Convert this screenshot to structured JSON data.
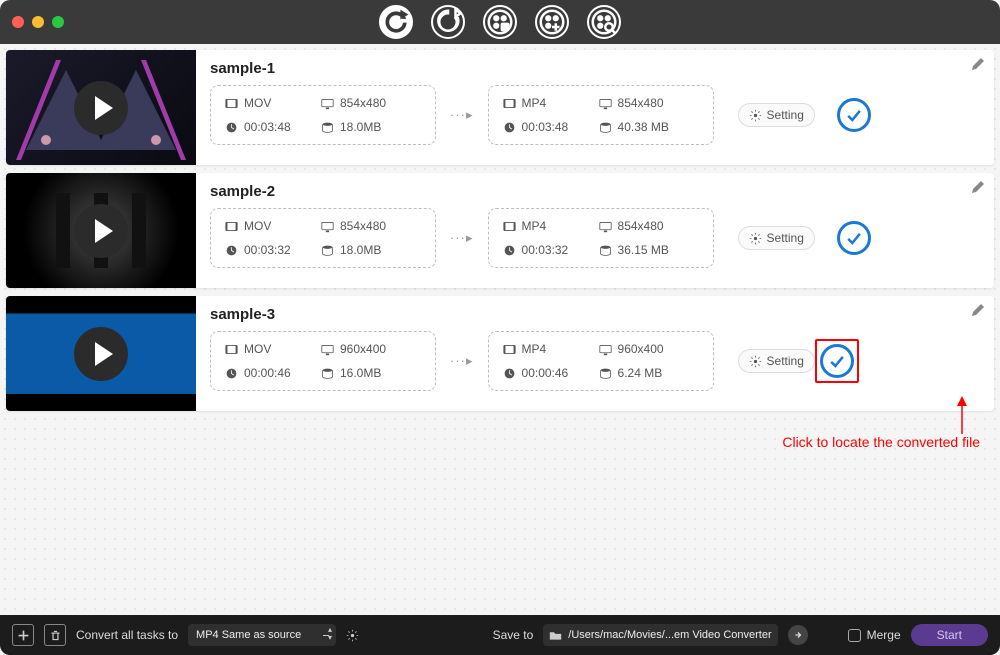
{
  "top_icons": [
    "sync",
    "refresh",
    "film-settings",
    "film-add",
    "film-search"
  ],
  "tasks": [
    {
      "name": "sample-1",
      "src": {
        "fmt": "MOV",
        "dur": "00:03:48",
        "res": "854x480",
        "size": "18.0MB"
      },
      "dst": {
        "fmt": "MP4",
        "dur": "00:03:48",
        "res": "854x480",
        "size": "40.38 MB"
      },
      "setting": "Setting",
      "thumb": "music-stage"
    },
    {
      "name": "sample-2",
      "src": {
        "fmt": "MOV",
        "dur": "00:03:32",
        "res": "854x480",
        "size": "18.0MB"
      },
      "dst": {
        "fmt": "MP4",
        "dur": "00:03:32",
        "res": "854x480",
        "size": "36.15 MB"
      },
      "setting": "Setting",
      "thumb": "dark-bars"
    },
    {
      "name": "sample-3",
      "src": {
        "fmt": "MOV",
        "dur": "00:00:46",
        "res": "960x400",
        "size": "16.0MB"
      },
      "dst": {
        "fmt": "MP4",
        "dur": "00:00:46",
        "res": "960x400",
        "size": "6.24 MB"
      },
      "setting": "Setting",
      "thumb": "blue-wide",
      "highlight": true
    }
  ],
  "annotation": "Click to locate the converted file",
  "bottom": {
    "convert_label": "Convert all tasks to",
    "preset": "MP4 Same as source",
    "save_label": "Save to",
    "path": "/Users/mac/Movies/...em Video Converter",
    "merge": "Merge",
    "start": "Start"
  }
}
